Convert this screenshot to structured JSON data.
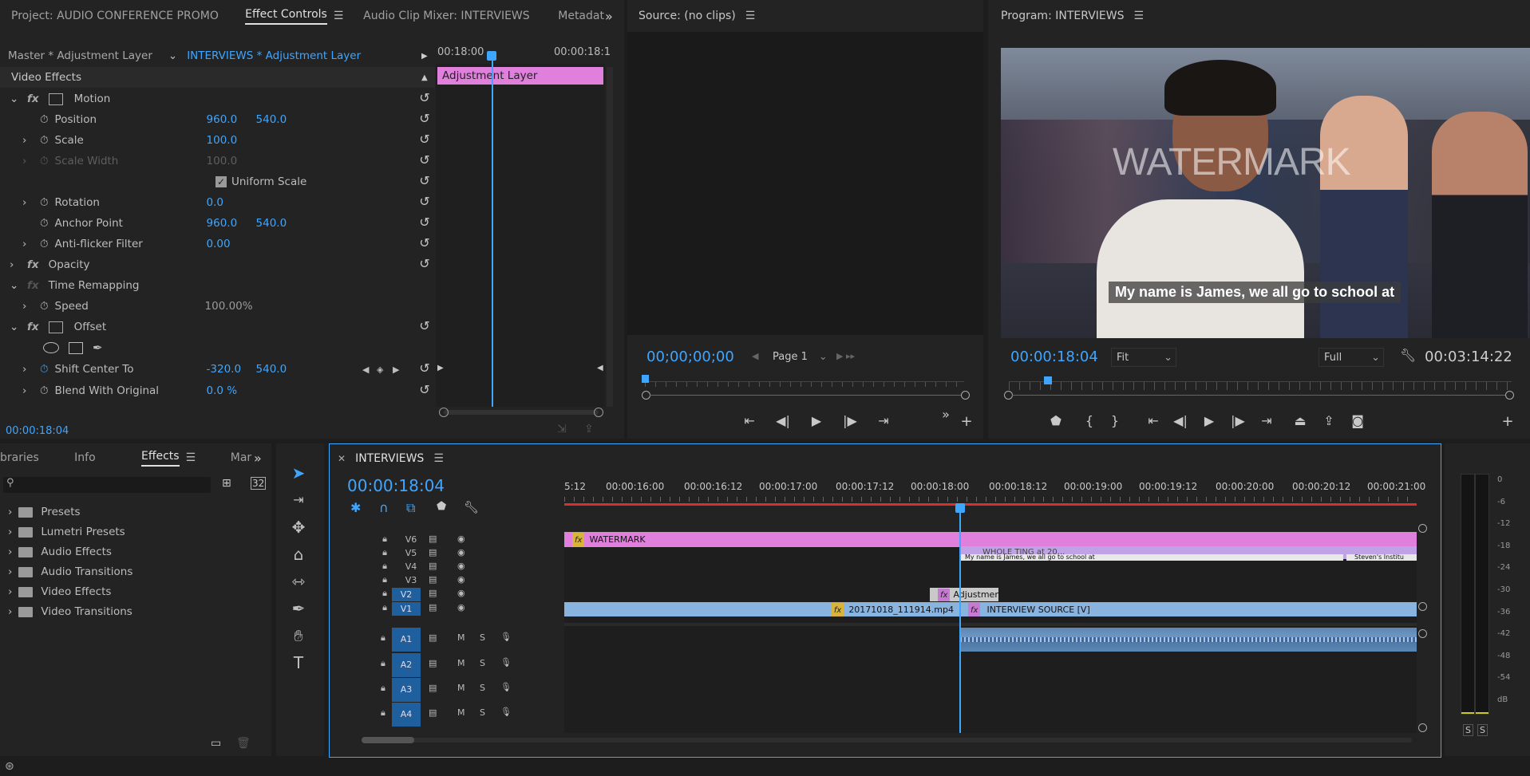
{
  "project_tabs": {
    "project": "Project: AUDIO CONFERENCE PROMO",
    "effect_controls": "Effect Controls",
    "audio_clip_mixer": "Audio Clip Mixer: INTERVIEWS",
    "metadata": "Metadat"
  },
  "effect_controls": {
    "master_label": "Master * Adjustment Layer",
    "sequence_label": "INTERVIEWS * Adjustment Layer",
    "timecode_start": "00:18:00",
    "timecode_end": "00:00:18:1",
    "clip_name": "Adjustment Layer",
    "section": "Video Effects",
    "motion": "Motion",
    "position": {
      "label": "Position",
      "x": "960.0",
      "y": "540.0"
    },
    "scale": {
      "label": "Scale",
      "value": "100.0"
    },
    "scale_width": {
      "label": "Scale Width",
      "value": "100.0"
    },
    "uniform_scale": "Uniform Scale",
    "rotation": {
      "label": "Rotation",
      "value": "0.0"
    },
    "anchor_point": {
      "label": "Anchor Point",
      "x": "960.0",
      "y": "540.0"
    },
    "anti_flicker": {
      "label": "Anti-flicker Filter",
      "value": "0.00"
    },
    "opacity": "Opacity",
    "time_remapping": "Time Remapping",
    "speed": {
      "label": "Speed",
      "value": "100.00%"
    },
    "offset": "Offset",
    "shift_center": {
      "label": "Shift Center To",
      "x": "-320.0",
      "y": "540.0"
    },
    "blend": {
      "label": "Blend With Original",
      "value": "0.0 %"
    },
    "current_time": "00:00:18:04"
  },
  "source": {
    "title": "Source: (no clips)",
    "timecode": "00;00;00;00",
    "page": "Page 1"
  },
  "program": {
    "title": "Program: INTERVIEWS",
    "watermark": "WATERMARK",
    "subtitle": "My name is James, we all go to school at",
    "timecode": "00:00:18:04",
    "zoom": "Fit",
    "quality": "Full",
    "duration": "00:03:14:22"
  },
  "effects_panel": {
    "tabs": [
      "braries",
      "Info",
      "Effects",
      "Mar"
    ],
    "items": [
      "Presets",
      "Lumetri Presets",
      "Audio Effects",
      "Audio Transitions",
      "Video Effects",
      "Video Transitions"
    ]
  },
  "timeline": {
    "name": "INTERVIEWS",
    "timecode": "00:00:18:04",
    "ruler": [
      "5:12",
      "00:00:16:00",
      "00:00:16:12",
      "00:00:17:00",
      "00:00:17:12",
      "00:00:18:00",
      "00:00:18:12",
      "00:00:19:00",
      "00:00:19:12",
      "00:00:20:00",
      "00:00:20:12",
      "00:00:21:00"
    ],
    "video_tracks": [
      "V6",
      "V5",
      "V4",
      "V3",
      "V2",
      "V1"
    ],
    "audio_tracks": [
      "A1",
      "A2",
      "A3",
      "A4"
    ],
    "clips": {
      "watermark": "WATERMARK",
      "v5_title": "WHOLE TING at 20...",
      "v5_sub": "My name is James, we all go to school at",
      "v5_right": "Steven's Institu",
      "adjustment": "Adjustment Laye",
      "v1_left": "20171018_111914.mp4",
      "v1_right": "INTERVIEW SOURCE [V]"
    },
    "track_letters": {
      "mute": "M",
      "solo": "S"
    }
  },
  "meters": {
    "scale": [
      "0",
      "-6",
      "-12",
      "-18",
      "-24",
      "-30",
      "-36",
      "-42",
      "-48",
      "-54",
      "dB"
    ],
    "solo": [
      "S",
      "S"
    ]
  },
  "colors": {
    "accent": "#3fa6ff",
    "adjustment_clip": "#e07fdc",
    "video_clip": "#8ab4e0",
    "playhead": "#3fa6ff"
  }
}
